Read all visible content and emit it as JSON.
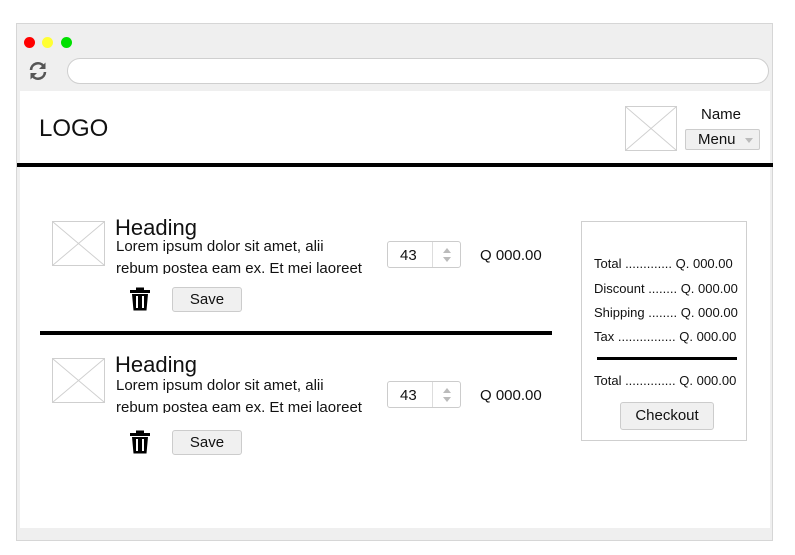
{
  "header": {
    "logo": "LOGO",
    "user_name": "Name",
    "menu_label": "Menu"
  },
  "cart_items": [
    {
      "heading": "Heading",
      "description": "Lorem ipsum dolor sit amet, alii rebum postea eam ex. Et mei laoreet",
      "quantity": "43",
      "price": "Q 000.00",
      "save_label": "Save"
    },
    {
      "heading": "Heading",
      "description": "Lorem ipsum dolor sit amet, alii rebum postea eam ex. Et mei laoreet",
      "quantity": "43",
      "price": "Q 000.00",
      "save_label": "Save"
    }
  ],
  "summary": {
    "total": "Total ............. Q. 000.00",
    "discount": "Discount ........ Q. 000.00",
    "shipping": "Shipping ........ Q. 000.00",
    "tax": "Tax ................ Q. 000.00",
    "grand_total": "Total .............. Q. 000.00",
    "checkout_label": "Checkout"
  },
  "icons": {
    "reload": "reload-icon",
    "trash": "trash-icon",
    "image_placeholder": "image-placeholder-icon"
  },
  "colors": {
    "close_dot": "#ff0000",
    "minimize_dot": "#ffff33",
    "maximize_dot": "#00e000"
  }
}
